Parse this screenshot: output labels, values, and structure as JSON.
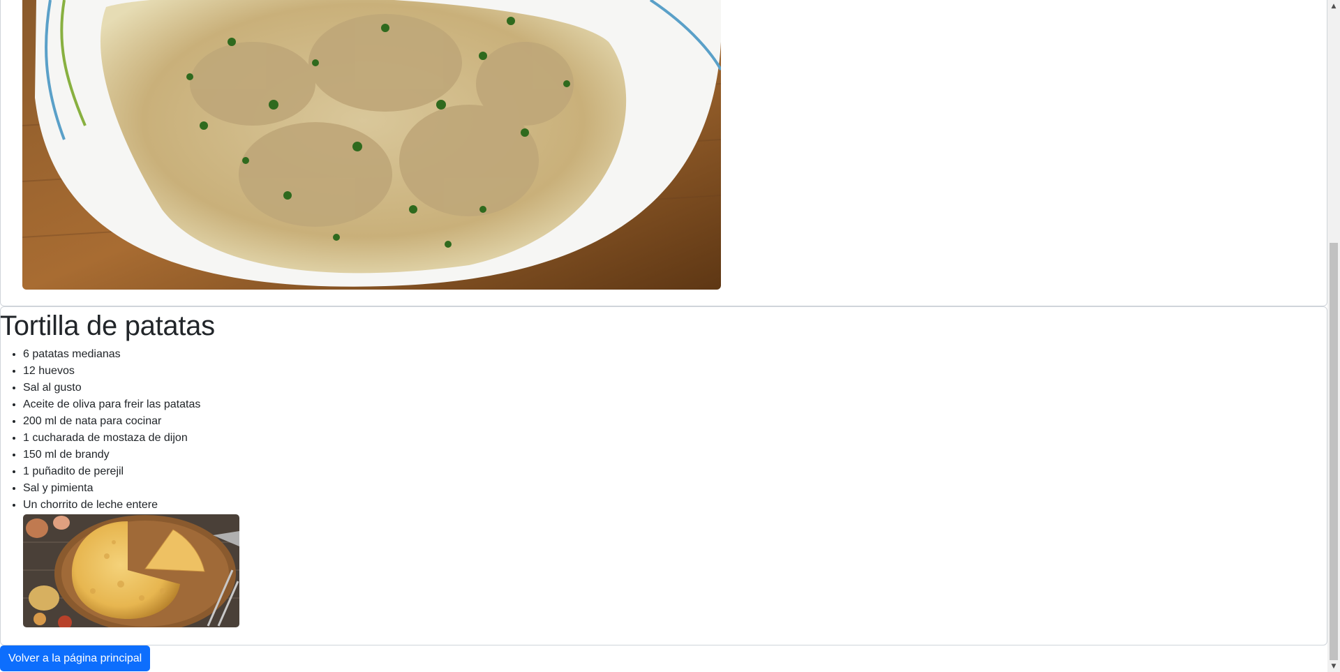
{
  "previous_recipe": {
    "image_alt": "plate-with-creamy-mushroom-chicken"
  },
  "recipe": {
    "title": "Tortilla de patatas",
    "ingredients": [
      "6 patatas medianas",
      "12 huevos",
      "Sal al gusto",
      "Aceite de oliva para freir las patatas",
      "200 ml de nata para cocinar",
      "1 cucharada de mostaza de dijon",
      "150 ml de brandy",
      "1 puñadito de perejil",
      "Sal y pimienta",
      "Un chorrito de leche entere"
    ],
    "image_alt": "spanish-omelette-on-wooden-board"
  },
  "back_button": {
    "label": "Volver a la página principal"
  },
  "colors": {
    "primary": "#0d6efd",
    "text": "#212529",
    "border": "#cfd4da"
  },
  "icons": {
    "scroll_up": "scroll-up-arrow-icon",
    "scroll_down": "scroll-down-arrow-icon"
  }
}
